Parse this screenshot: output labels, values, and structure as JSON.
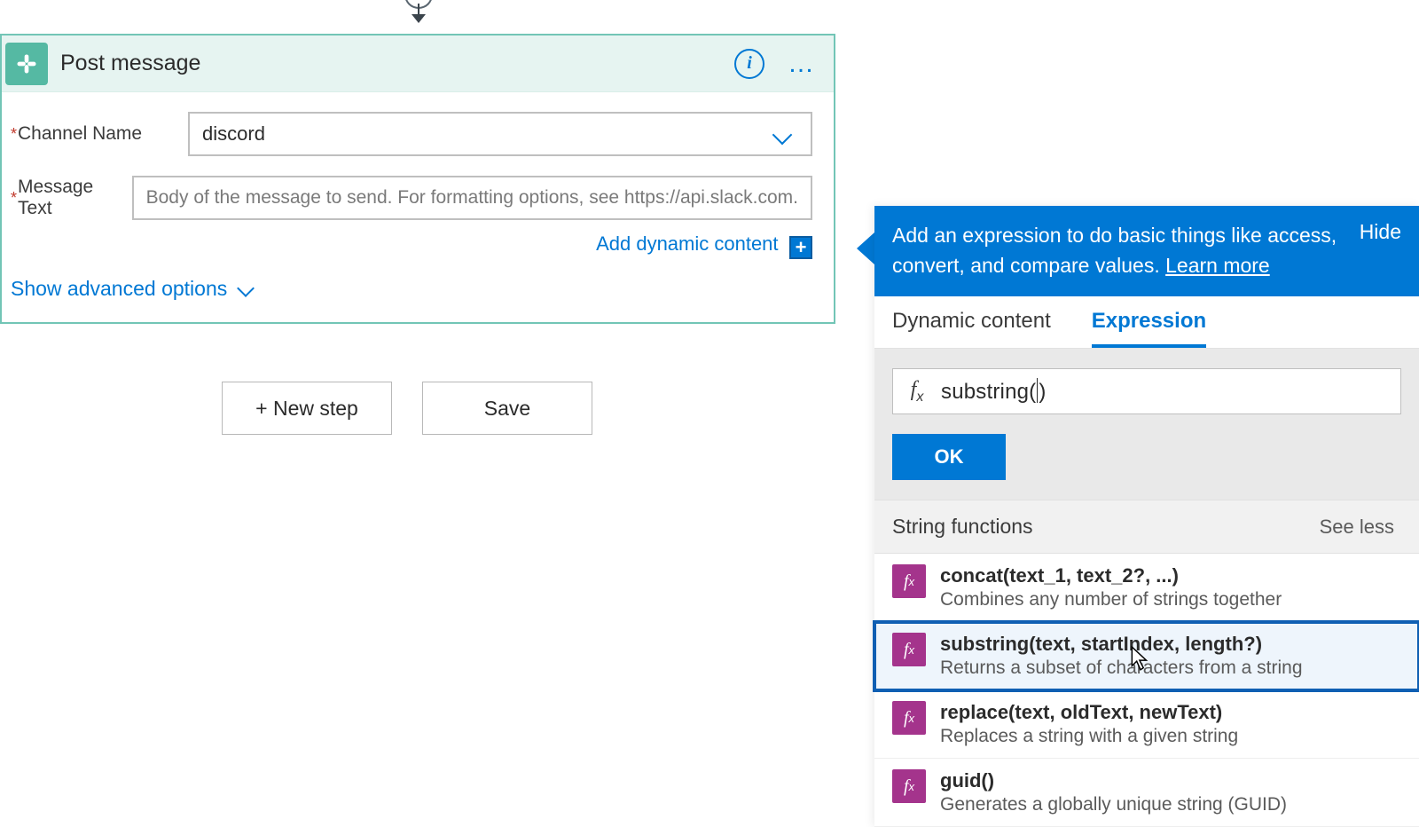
{
  "flow": {
    "card": {
      "title": "Post message",
      "fields": {
        "channel": {
          "label": "Channel Name",
          "value": "discord"
        },
        "message": {
          "label": "Message Text",
          "placeholder": "Body of the message to send. For formatting options, see https://api.slack.com."
        }
      },
      "add_dynamic_label": "Add dynamic content",
      "advanced_label": "Show advanced options"
    },
    "buttons": {
      "new_step": "+ New step",
      "save": "Save"
    }
  },
  "panel": {
    "banner_text_1": "Add an expression to do basic things like access, convert, and compare values. ",
    "banner_learn_more": "Learn more",
    "banner_hide": "Hide",
    "tabs": {
      "dynamic": "Dynamic content",
      "expression": "Expression"
    },
    "expression_before": "substring(",
    "expression_after": ")",
    "ok": "OK",
    "group_title": "String functions",
    "see_less": "See less",
    "functions": [
      {
        "sig": "concat(text_1, text_2?, ...)",
        "desc": "Combines any number of strings together"
      },
      {
        "sig": "substring(text, startIndex, length?)",
        "desc": "Returns a subset of characters from a string"
      },
      {
        "sig": "replace(text, oldText, newText)",
        "desc": "Replaces a string with a given string"
      },
      {
        "sig": "guid()",
        "desc": "Generates a globally unique string (GUID)"
      }
    ],
    "selected_index": 1
  }
}
